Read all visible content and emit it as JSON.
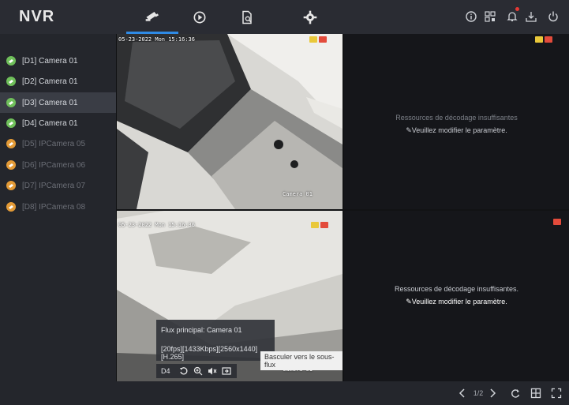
{
  "app": {
    "title": "NVR"
  },
  "nav": {
    "items": [
      {
        "id": "live-view",
        "icon": "camera-icon",
        "active": true
      },
      {
        "id": "playback",
        "icon": "playback-icon",
        "active": false
      },
      {
        "id": "search",
        "icon": "file-search-icon",
        "active": false
      },
      {
        "id": "settings",
        "icon": "gear-icon",
        "active": false
      }
    ]
  },
  "topbar_icons": [
    "info-icon",
    "qr-code-icon",
    "bell-icon",
    "download-icon",
    "power-icon"
  ],
  "cameras": [
    {
      "label": "[D1] Camera 01",
      "status": "online"
    },
    {
      "label": "[D2] Camera 01",
      "status": "online"
    },
    {
      "label": "[D3] Camera 01",
      "status": "online",
      "selected": true
    },
    {
      "label": "[D4] Camera 01",
      "status": "online"
    },
    {
      "label": "[D5] IPCamera 05",
      "status": "offline"
    },
    {
      "label": "[D6] IPCamera 06",
      "status": "offline"
    },
    {
      "label": "[D7] IPCamera 07",
      "status": "offline"
    },
    {
      "label": "[D8] IPCamera 08",
      "status": "offline"
    }
  ],
  "tiles": {
    "t1": {
      "osd_time": "05-23-2022 Mon 15:16:36",
      "osd_name": "Camera 01"
    },
    "t2": {
      "line1": "Ressources de décodage insuffisantes",
      "line2": "Veuillez modifier le paramètre."
    },
    "t3": {
      "osd_time": "05-23-2022 Mon 15:16:36",
      "osd_name": "Camera 01"
    },
    "t4": {
      "line1": "Ressources de décodage insuffisantes.",
      "line2": "Veuillez modifier le paramètre."
    }
  },
  "overlay": {
    "stream_title": "Flux principal: Camera 01",
    "stream_info": "[20fps][1433Kbps][2560x1440][H.265]",
    "channel": "D4",
    "tooltip": "Basculer vers le sous-flux"
  },
  "pager": {
    "page": "1/2"
  },
  "colors": {
    "accent": "#2f8be6",
    "online": "#6fbf5a",
    "offline": "#e39a36"
  }
}
